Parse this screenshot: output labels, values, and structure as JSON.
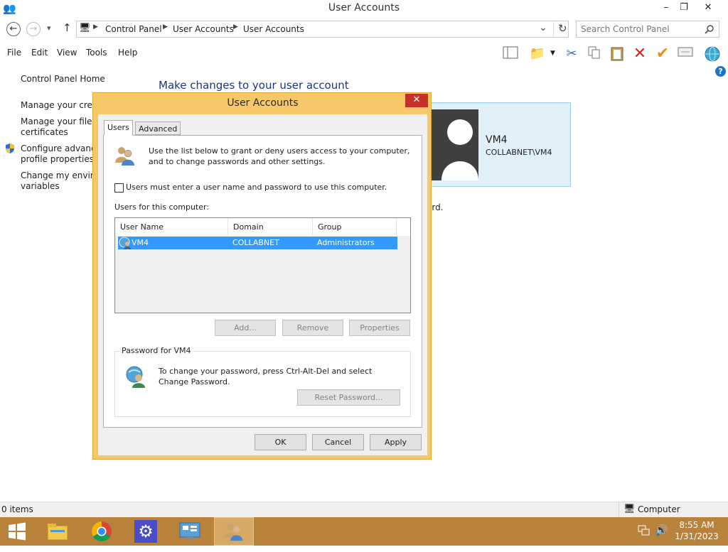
{
  "window": {
    "title": "User Accounts",
    "controls": {
      "minimize": "–",
      "restore": "❐",
      "close": "✕"
    }
  },
  "address": {
    "back": "←",
    "forward": "→",
    "recent": "▾",
    "up": "↑",
    "breadcrumb": [
      "Control Panel",
      "User Accounts",
      "User Accounts"
    ],
    "dropdown": "⌄",
    "refresh": "↻",
    "search_placeholder": "Search Control Panel"
  },
  "menu": [
    "File",
    "Edit",
    "View",
    "Tools",
    "Help"
  ],
  "left_pane": {
    "home": "Control Panel Home",
    "links": [
      {
        "line1": "Manage your crede",
        "line2": ""
      },
      {
        "line1": "Manage your file er",
        "line2": "certificates"
      },
      {
        "line1": "Configure advance",
        "line2": "profile properties"
      },
      {
        "line1": "Change my environ",
        "line2": "variables"
      }
    ]
  },
  "main": {
    "heading": "Make changes to your user account",
    "tile_name": "VM4",
    "tile_domain": "COLLABNET\\VM4",
    "fragment": "ord."
  },
  "dialog": {
    "title": "User Accounts",
    "close": "✕",
    "tabs": [
      "Users",
      "Advanced"
    ],
    "intro": "Use the list below to grant or deny users access to your computer, and to change passwords and other settings.",
    "checkbox_label": "Users must enter a user name and password to use this computer.",
    "list_label": "Users for this computer:",
    "columns": [
      "User Name",
      "Domain",
      "Group"
    ],
    "rows": [
      {
        "name": "VM4",
        "domain": "COLLABNET",
        "group": "Administrators"
      }
    ],
    "buttons": {
      "add": "Add...",
      "remove": "Remove",
      "properties": "Properties"
    },
    "password_group": "Password for VM4",
    "password_text": "To change your password, press Ctrl-Alt-Del and select Change Password.",
    "reset_password": "Reset Password...",
    "ok": "OK",
    "cancel": "Cancel",
    "apply": "Apply"
  },
  "status": {
    "items": "0 items",
    "computer": "Computer"
  },
  "taskbar": {
    "time": "8:55 AM",
    "date": "1/31/2023"
  },
  "colors": {
    "dialog_frame": "#f6c868",
    "selection": "#3399ff",
    "taskbar": "#b9823a",
    "heading": "#1e3287"
  }
}
